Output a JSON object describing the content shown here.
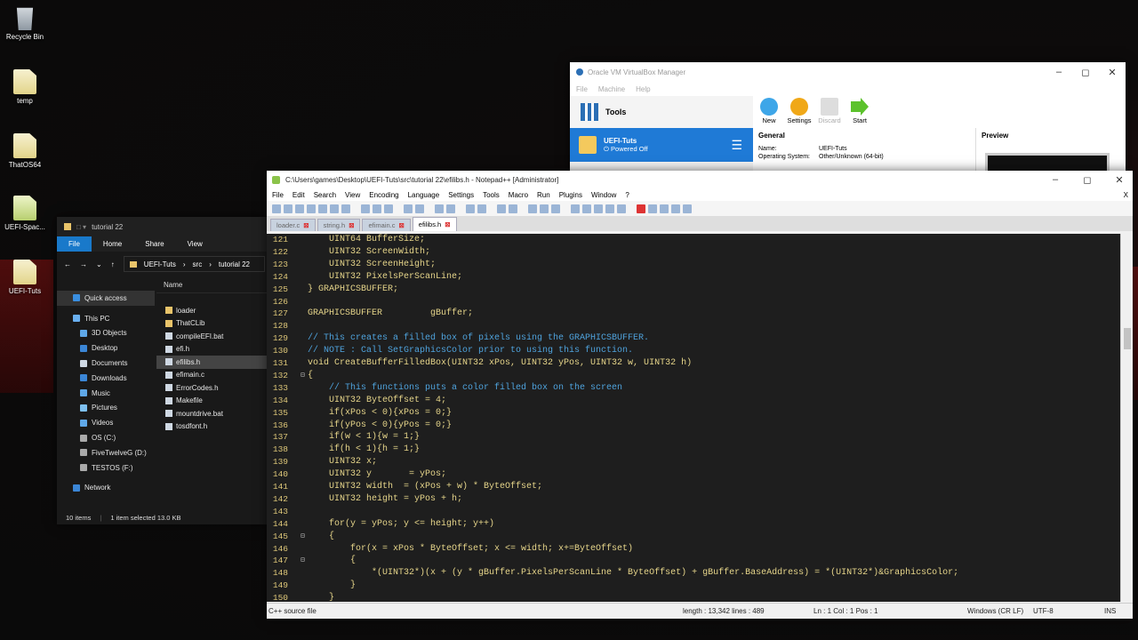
{
  "desktop": {
    "icons": [
      {
        "label": "Recycle Bin",
        "type": "bin"
      },
      {
        "label": "temp",
        "type": "file"
      },
      {
        "label": "ThatOS64",
        "type": "file"
      },
      {
        "label": "UEFI-Spac...",
        "type": "app"
      },
      {
        "label": "UEFI-Tuts",
        "type": "file"
      }
    ]
  },
  "vbox": {
    "title": "Oracle VM VirtualBox Manager",
    "menu": [
      "File",
      "Machine",
      "Help"
    ],
    "tools_label": "Tools",
    "vm_name": "UEFI-Tuts",
    "vm_state": "Powered Off",
    "toolbar": [
      "New",
      "Settings",
      "Discard",
      "Start"
    ],
    "general_header": "General",
    "preview_header": "Preview",
    "name_key": "Name:",
    "name_val": "UEFI-Tuts",
    "os_key": "Operating System:",
    "os_val": "Other/Unknown (64-bit)"
  },
  "explorer": {
    "title": "tutorial 22",
    "ribbon": [
      "File",
      "Home",
      "Share",
      "View"
    ],
    "path": [
      "UEFI-Tuts",
      "src",
      "tutorial 22"
    ],
    "nav": [
      "Quick access",
      "This PC",
      "3D Objects",
      "Desktop",
      "Documents",
      "Downloads",
      "Music",
      "Pictures",
      "Videos",
      "OS (C:)",
      "FiveTwelveG (D:)",
      "TESTOS (F:)",
      "Network"
    ],
    "column": "Name",
    "files": [
      "loader",
      "ThatCLib",
      "compileEFI.bat",
      "efi.h",
      "efilibs.h",
      "efimain.c",
      "ErrorCodes.h",
      "Makefile",
      "mountdrive.bat",
      "tosdfont.h"
    ],
    "status_count": "10 items",
    "status_sel": "1 item selected  13.0 KB"
  },
  "npp": {
    "title": "C:\\Users\\games\\Desktop\\UEFI-Tuts\\src\\tutorial 22\\efilibs.h - Notepad++ [Administrator]",
    "menu": [
      "File",
      "Edit",
      "Search",
      "View",
      "Encoding",
      "Language",
      "Settings",
      "Tools",
      "Macro",
      "Run",
      "Plugins",
      "Window",
      "?"
    ],
    "close_x": "X",
    "tabs": [
      "loader.c",
      "string.h",
      "efimain.c",
      "efilibs.h"
    ],
    "status": {
      "type": "C++ source file",
      "length": "length : 13,342    lines : 489",
      "pos": "Ln : 1    Col : 1    Pos : 1",
      "eol": "Windows (CR LF)",
      "enc": "UTF-8",
      "ins": "INS"
    },
    "lines": [
      {
        "n": "121",
        "t": "    UINT64 BufferSize;"
      },
      {
        "n": "122",
        "t": "    UINT32 ScreenWidth;"
      },
      {
        "n": "123",
        "t": "    UINT32 ScreenHeight;"
      },
      {
        "n": "124",
        "t": "    UINT32 PixelsPerScanLine;"
      },
      {
        "n": "125",
        "t": "} GRAPHICSBUFFER;"
      },
      {
        "n": "126",
        "t": ""
      },
      {
        "n": "127",
        "t": "GRAPHICSBUFFER         gBuffer;"
      },
      {
        "n": "128",
        "t": ""
      },
      {
        "n": "129",
        "t": "// This creates a filled box of pixels using the GRAPHICSBUFFER.",
        "c": "blue"
      },
      {
        "n": "130",
        "t": "// NOTE : Call SetGraphicsColor prior to using this function.",
        "c": "blue"
      },
      {
        "n": "131",
        "t": "void CreateBufferFilledBox(UINT32 xPos, UINT32 yPos, UINT32 w, UINT32 h)"
      },
      {
        "n": "132",
        "t": "{",
        "fold": "⊟"
      },
      {
        "n": "133",
        "t": "    // This functions puts a color filled box on the screen",
        "c": "blue"
      },
      {
        "n": "134",
        "t": "    UINT32 ByteOffset = 4;"
      },
      {
        "n": "135",
        "t": "    if(xPos < 0){xPos = 0;}"
      },
      {
        "n": "136",
        "t": "    if(yPos < 0){yPos = 0;}"
      },
      {
        "n": "137",
        "t": "    if(w < 1){w = 1;}"
      },
      {
        "n": "138",
        "t": "    if(h < 1){h = 1;}"
      },
      {
        "n": "139",
        "t": "    UINT32 x;"
      },
      {
        "n": "140",
        "t": "    UINT32 y       = yPos;"
      },
      {
        "n": "141",
        "t": "    UINT32 width  = (xPos + w) * ByteOffset;"
      },
      {
        "n": "142",
        "t": "    UINT32 height = yPos + h;"
      },
      {
        "n": "143",
        "t": ""
      },
      {
        "n": "144",
        "t": "    for(y = yPos; y <= height; y++)"
      },
      {
        "n": "145",
        "t": "    {",
        "fold": "⊟"
      },
      {
        "n": "146",
        "t": "        for(x = xPos * ByteOffset; x <= width; x+=ByteOffset)"
      },
      {
        "n": "147",
        "t": "        {",
        "fold": "⊟"
      },
      {
        "n": "148",
        "t": "            *(UINT32*)(x + (y * gBuffer.PixelsPerScanLine * ByteOffset) + gBuffer.BaseAddress) = *(UINT32*)&GraphicsColor;"
      },
      {
        "n": "149",
        "t": "        }"
      },
      {
        "n": "150",
        "t": "    }"
      }
    ]
  },
  "colors": {
    "accent": "#1f7ad6",
    "explorer_file_tab": "#1979ca",
    "code_text": "#e6d58a",
    "code_comment": "#4fa3dd",
    "line_numbers": "#e0c97a"
  }
}
